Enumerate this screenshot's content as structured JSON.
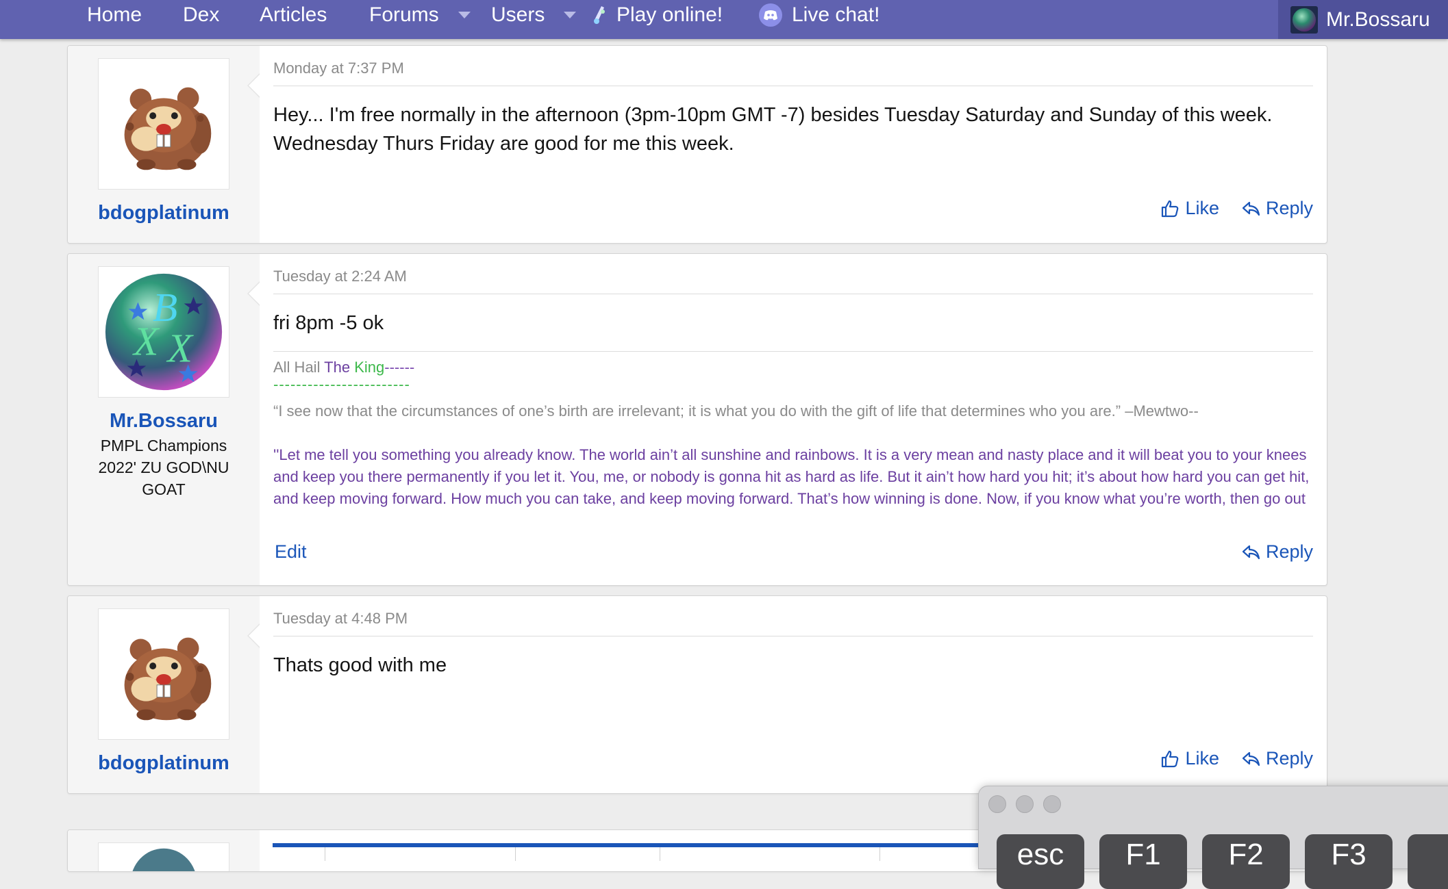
{
  "nav": {
    "items": [
      {
        "label": "Home",
        "dropdown": false,
        "icon": ""
      },
      {
        "label": "Dex",
        "dropdown": false,
        "icon": ""
      },
      {
        "label": "Articles",
        "dropdown": false,
        "icon": ""
      },
      {
        "label": "Forums",
        "dropdown": true,
        "icon": ""
      },
      {
        "label": "Users",
        "dropdown": true,
        "icon": ""
      },
      {
        "label": "Play online!",
        "dropdown": false,
        "icon": "showdown-icon"
      },
      {
        "label": "Live chat!",
        "dropdown": false,
        "icon": "discord-icon"
      }
    ],
    "user": "Mr.Bossaru",
    "color": "#6062b0"
  },
  "posts": [
    {
      "date": "Monday at 7:37 PM",
      "username": "bdogplatinum",
      "avatar": "bidoof-avatar",
      "body": "Hey... I'm free normally in the afternoon (3pm-10pm GMT -7) besides Tuesday Saturday and Sunday of this week. Wednesday Thurs Friday are good for me this week.",
      "actions": {
        "like": "Like",
        "reply": "Reply"
      }
    },
    {
      "date": "Tuesday at 2:24 AM",
      "username": "Mr.Bossaru",
      "usertitle": "PMPL Champions 2022' ZU GOD\\NU GOAT",
      "avatar": "bxx-orb-avatar",
      "body": "fri 8pm -5 ok",
      "signature": {
        "hail": "All Hail",
        "the": " The ",
        "king": "King",
        "dash1": "------",
        "dash2": "------------------------",
        "quote1": "“I see now that the circumstances of one’s birth are irrelevant; it is what you do with the gift of life that determines who you are.” –Mewtwo--",
        "quote2": "''Let me tell you something you already know. The world ain’t all sunshine and rainbows. It is a very mean and nasty place and it will beat you to your knees and keep you there permanently if you let it. You, me, or nobody is gonna hit as hard as life. But it ain’t how hard you hit; it’s about how hard you can get hit, and keep moving forward. How much you can take, and keep moving forward. That’s how winning is done. Now, if you know what you’re worth, then go out and get what you’re worth. But you gotta be willing to take the hit, and not pointing fingers"
      },
      "actions": {
        "edit": "Edit",
        "reply": "Reply"
      }
    },
    {
      "date": "Tuesday at 4:48 PM",
      "username": "bdogplatinum",
      "avatar": "bidoof-avatar",
      "body": "Thats good with me",
      "actions": {
        "like": "Like",
        "reply": "Reply"
      }
    }
  ],
  "keyboard": {
    "keys": [
      "esc",
      "F1",
      "F2",
      "F3"
    ]
  },
  "colors": {
    "link": "#1a55b8",
    "sig_purple": "#6b3fa0",
    "sig_green": "#3cb84a"
  }
}
